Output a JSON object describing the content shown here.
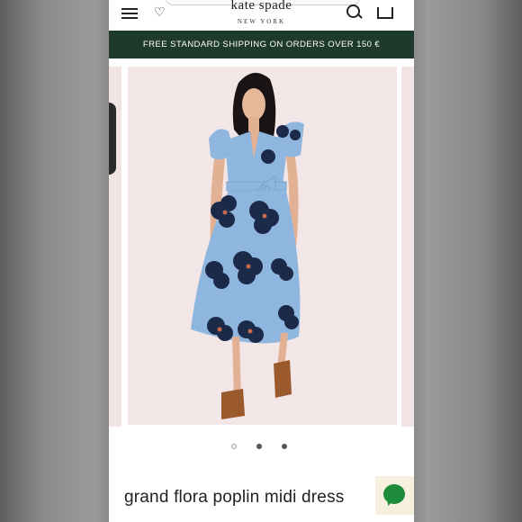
{
  "header": {
    "logo_text": "kate spade",
    "logo_sub": "NEW YORK",
    "icons": [
      "menu-icon",
      "heart-icon",
      "search-icon",
      "bag-icon"
    ]
  },
  "banner": {
    "text": "FREE STANDARD SHIPPING ON ORDERS OVER 150 €",
    "bg_color": "#1e3a2d"
  },
  "gallery": {
    "slide_count": 3,
    "active_slide": 2
  },
  "product": {
    "title": "grand flora poplin midi dress"
  },
  "colors": {
    "dress_blue": "#8fb6df",
    "flower_navy": "#1c2a4a",
    "sandals_brown": "#9a5a2c",
    "chat_green": "#1e8b3a"
  }
}
